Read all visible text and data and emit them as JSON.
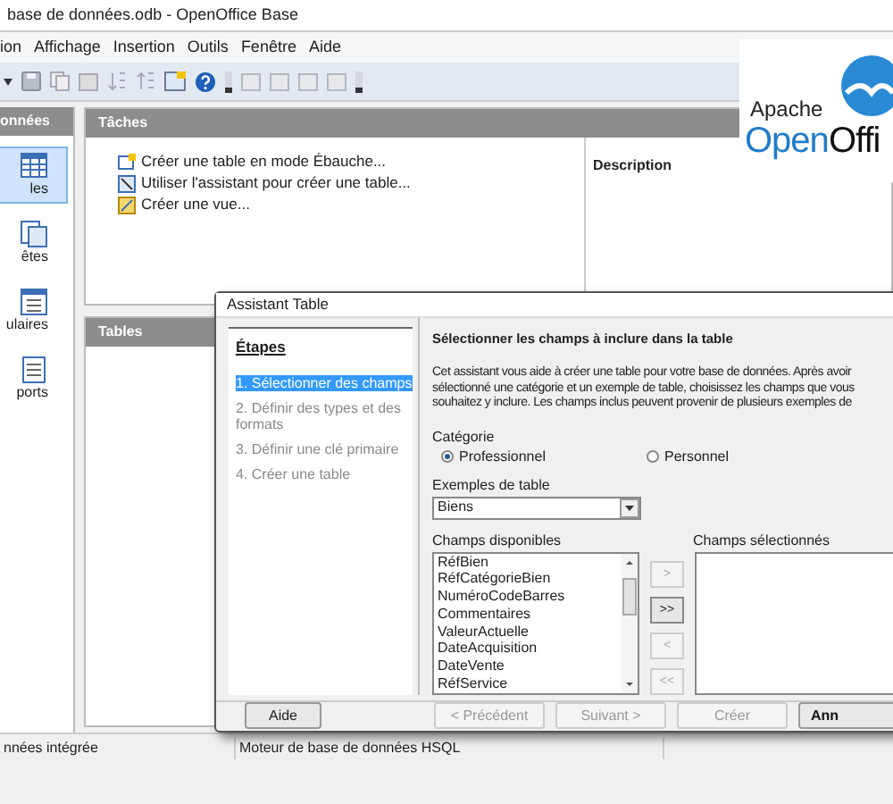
{
  "window": {
    "title": "base de données.odb - OpenOffice Base"
  },
  "menu": [
    "ion",
    "Affichage",
    "Insertion",
    "Outils",
    "Fenêtre",
    "Aide"
  ],
  "logo": {
    "line1": "Apache",
    "line2a": "Open",
    "line2b": "Offi"
  },
  "sidebar": {
    "title": "onnées",
    "items": [
      {
        "label": "les",
        "selected": true
      },
      {
        "label": "êtes",
        "selected": false
      },
      {
        "label": "ulaires",
        "selected": false
      },
      {
        "label": "ports",
        "selected": false
      }
    ]
  },
  "tasks": {
    "title": "Tâches",
    "items": [
      "Créer une table en mode Ébauche...",
      "Utiliser l'assistant pour créer une table...",
      "Créer une vue..."
    ],
    "description_label": "Description"
  },
  "tables_panel": {
    "title": "Tables"
  },
  "dialog": {
    "title": "Assistant Table",
    "steps_title": "Étapes",
    "steps": [
      {
        "label": "1. Sélectionner des champs",
        "selected": true
      },
      {
        "label": "2. Définir des types et des formats",
        "selected": false
      },
      {
        "label": "3. Définir une clé primaire",
        "selected": false
      },
      {
        "label": "4. Créer une table",
        "selected": false
      }
    ],
    "heading": "Sélectionner les champs à inclure dans la table",
    "intro_lines": [
      "Cet assistant vous aide à créer une table pour votre base de données. Après avoir",
      "sélectionné une catégorie et un exemple de table, choisissez les champs que vous",
      "souhaitez y inclure. Les champs inclus peuvent provenir de plusieurs exemples de"
    ],
    "category_label": "Catégorie",
    "categories": [
      {
        "label": "Professionnel",
        "selected": true
      },
      {
        "label": "Personnel",
        "selected": false
      }
    ],
    "examples_label": "Exemples de table",
    "example_value": "Biens",
    "available_label": "Champs disponibles",
    "available": [
      "RéfBien",
      "RéfCatégorieBien",
      "NuméroCodeBarres",
      "Commentaires",
      "ValeurActuelle",
      "DateAcquisition",
      "DateVente",
      "RéfService"
    ],
    "move_buttons": [
      {
        "label": ">",
        "disabled": true
      },
      {
        "label": ">>",
        "disabled": false
      },
      {
        "label": "<",
        "disabled": true
      },
      {
        "label": "<<",
        "disabled": true
      }
    ],
    "selected_label": "Champs sélectionnés",
    "help_button": "Aide",
    "nav_buttons": [
      {
        "label": "< Précédent",
        "disabled": true
      },
      {
        "label": "Suivant >",
        "disabled": true
      },
      {
        "label": "Créer",
        "disabled": true
      },
      {
        "label": "Ann",
        "disabled": false
      }
    ]
  },
  "status_bar": [
    "nnées intégrée",
    "Moteur de base de données HSQL"
  ]
}
